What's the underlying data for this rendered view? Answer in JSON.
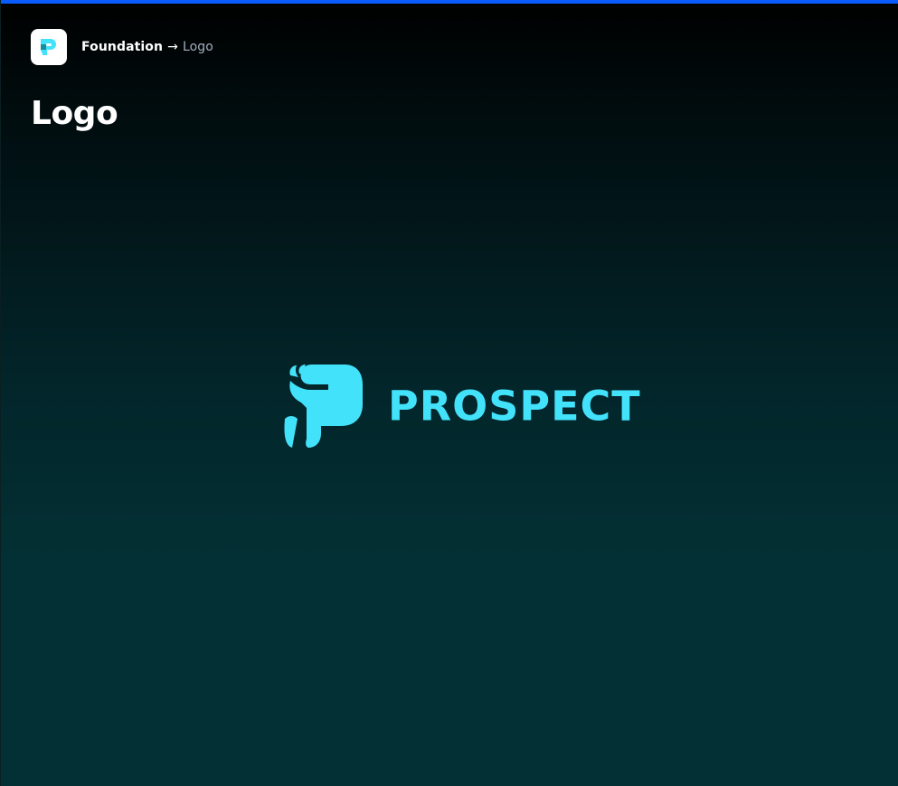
{
  "colors": {
    "accent": "#0a5dfc",
    "brand": "#43e2fb",
    "brand_dark": "#137b87"
  },
  "header": {
    "logo_icon": "prospect-p-icon",
    "breadcrumb": {
      "parent": "Foundation",
      "separator": "→",
      "current": "Logo"
    }
  },
  "page": {
    "title": "Logo"
  },
  "brand": {
    "mark_icon": "prospect-p-mark-icon",
    "wordmark": "PROSPECT"
  }
}
